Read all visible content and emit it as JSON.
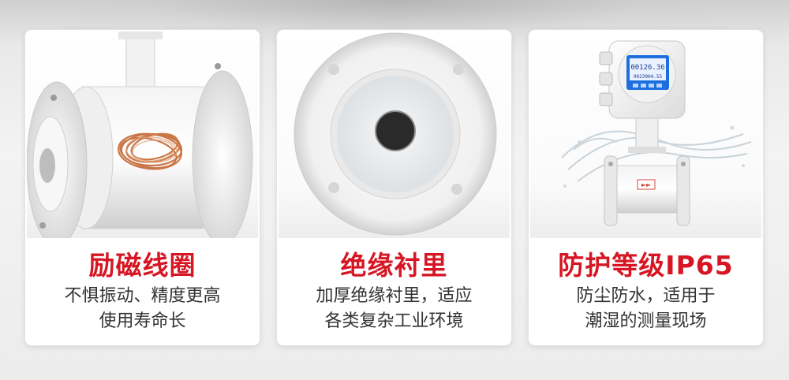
{
  "colors": {
    "title_red": "#d61623",
    "body_text": "#333333",
    "card_bg": "#ffffff",
    "page_bg": "#ececec",
    "copper": "#c8703f",
    "display_blue": "#1d6fe0"
  },
  "cards": [
    {
      "title": "励磁线圈",
      "desc_line1": "不惧振动、精度更高",
      "desc_line2": "使用寿命长",
      "image": "excitation-coil-flowmeter-body"
    },
    {
      "title": "绝缘衬里",
      "desc_line1": "加厚绝缘衬里，适应",
      "desc_line2": "各类复杂工业环境",
      "image": "insulated-lining-flange"
    },
    {
      "title": "防护等级IP65",
      "desc_line1": "防尘防水，适用于",
      "desc_line2": "潮湿的测量现场",
      "image": "ip65-flowmeter-with-water-splash",
      "display": {
        "reading_1": "00126.36",
        "reading_2": "00239H4.55"
      }
    }
  ]
}
